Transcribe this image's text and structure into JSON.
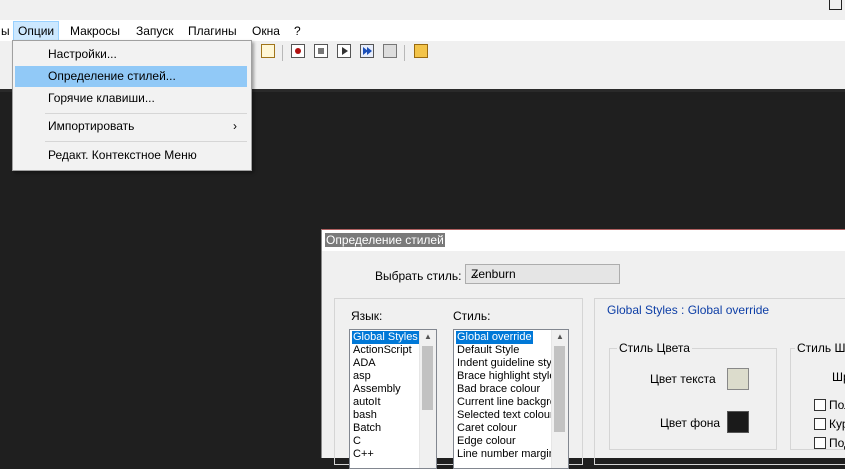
{
  "menubar": {
    "items": [
      "ы",
      "Опции",
      "Макросы",
      "Запуск",
      "Плагины",
      "Окна",
      "?"
    ]
  },
  "options_menu": {
    "items": [
      {
        "label": "Настройки..."
      },
      {
        "label": "Определение стилей..."
      },
      {
        "label": "Горячие клавиши..."
      },
      {
        "label": "Импортировать",
        "submenu_arrow": "›"
      },
      {
        "label": "Редакт. Контекстное Меню"
      }
    ]
  },
  "dialog": {
    "title": "Определение стилей",
    "select_style_label": "Выбрать стиль:",
    "select_style_value": "Zenburn",
    "language_label": "Язык:",
    "style_label": "Стиль:",
    "languages": [
      "Global Styles",
      "ActionScript",
      "ADA",
      "asp",
      "Assembly",
      "autoIt",
      "bash",
      "Batch",
      "C",
      "C++"
    ],
    "styles": [
      "Global override",
      "Default Style",
      "Indent guideline style",
      "Brace highlight style",
      "Bad brace colour",
      "Current line background",
      "Selected text colour",
      "Caret colour",
      "Edge colour",
      "Line number margin"
    ],
    "breadcrumb": "Global Styles : Global override",
    "color_group": "Стиль Цвета",
    "fg_label": "Цвет текста",
    "bg_label": "Цвет фона",
    "font_group": "Стиль Шр",
    "font_partial": "Шр",
    "checkboxes": [
      "Пол",
      "Кур",
      "Под"
    ],
    "colors": {
      "foreground": "#dcdccc",
      "background": "#1a1a1a"
    }
  }
}
